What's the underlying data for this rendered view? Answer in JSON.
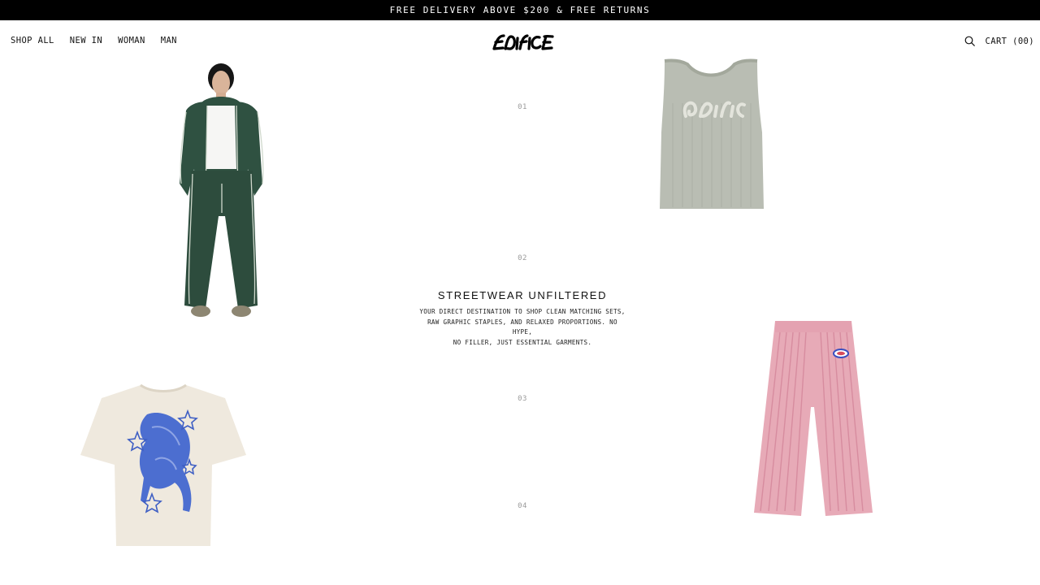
{
  "announcement": "FREE DELIVERY ABOVE $200 & FREE RETURNS",
  "nav": {
    "left": [
      "SHOP ALL",
      "NEW IN",
      "WOMAN",
      "MAN"
    ],
    "logo": "EDIFICE",
    "cart_label": "CART (00)"
  },
  "icons": {
    "search": "search-icon"
  },
  "hero": {
    "title": "STREETWEAR UNFILTERED",
    "description_lines": [
      "YOUR DIRECT DESTINATION TO SHOP CLEAN MATCHING SETS,",
      "RAW GRAPHIC STAPLES, AND RELAXED PROPORTIONS. NO HYPE,",
      "NO FILLER, JUST ESSENTIAL GARMENTS."
    ]
  },
  "indices": [
    "01",
    "02",
    "03",
    "04"
  ],
  "products": [
    {
      "name": "green-tracksuit-look",
      "color": "#2f5141"
    },
    {
      "name": "grey-logo-tank",
      "color": "#b7bbb1"
    },
    {
      "name": "horse-graphic-tee",
      "color": "#efe9de"
    },
    {
      "name": "pink-striped-jeans",
      "color": "#e7aab7"
    }
  ],
  "colors": {
    "accent": "#000000",
    "index_text": "#9a9a9a"
  }
}
